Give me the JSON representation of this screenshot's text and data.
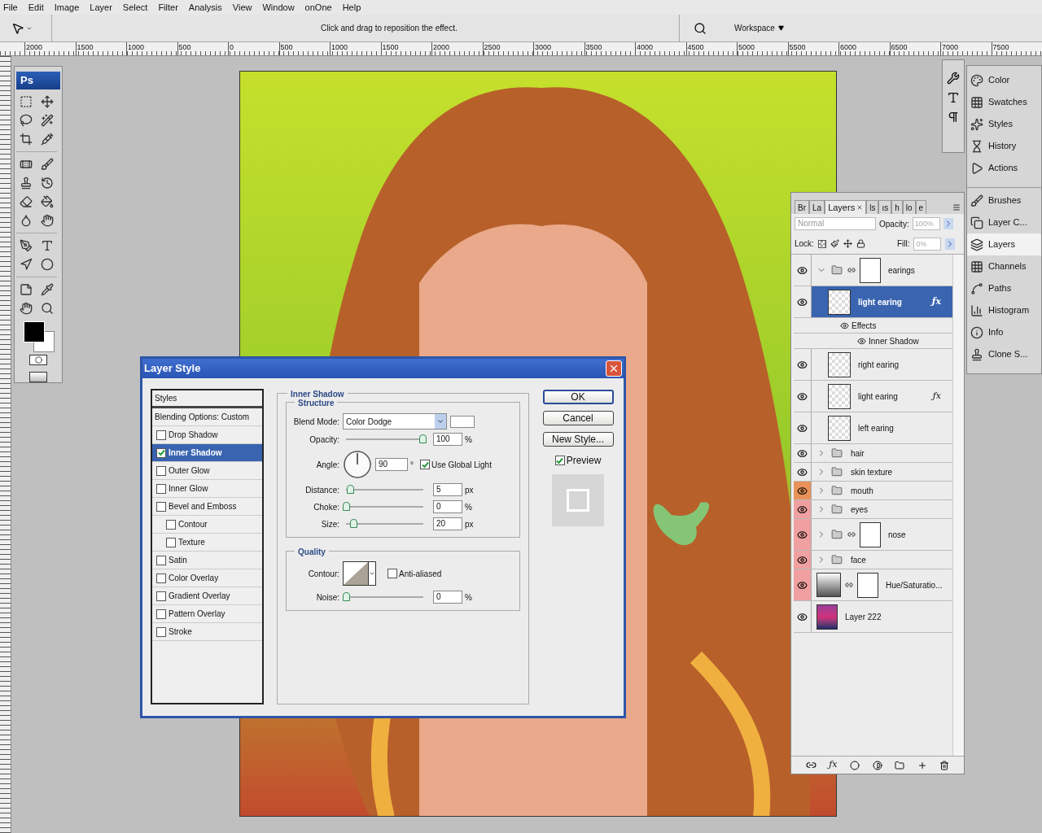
{
  "menu": [
    "File",
    "Edit",
    "Image",
    "Layer",
    "Select",
    "Filter",
    "Analysis",
    "View",
    "Window",
    "onOne",
    "Help"
  ],
  "options_bar": {
    "hint": "Click and drag to reposition the effect.",
    "workspace": "Workspace"
  },
  "ruler": [
    "2000",
    "1500",
    "1000",
    "500",
    "0",
    "500",
    "1000",
    "1500",
    "2000",
    "2500",
    "3000",
    "3500",
    "4000",
    "4500",
    "5000",
    "5500",
    "6000",
    "6500",
    "7000",
    "7500"
  ],
  "toolbox": {
    "logo": "Ps"
  },
  "dialog": {
    "title": "Layer Style",
    "styles_list": [
      {
        "label": "Styles",
        "kind": "header",
        "selected": false
      },
      {
        "label": "Blending Options: Custom",
        "kind": "header",
        "selected": false
      },
      {
        "label": "Drop Shadow",
        "kind": "option",
        "checked": false,
        "selected": false
      },
      {
        "label": "Inner Shadow",
        "kind": "option",
        "checked": true,
        "selected": true
      },
      {
        "label": "Outer Glow",
        "kind": "option",
        "checked": false,
        "selected": false
      },
      {
        "label": "Inner Glow",
        "kind": "option",
        "checked": false,
        "selected": false
      },
      {
        "label": "Bevel and Emboss",
        "kind": "option",
        "checked": false,
        "selected": false
      },
      {
        "label": "Contour",
        "kind": "sub",
        "checked": false,
        "selected": false
      },
      {
        "label": "Texture",
        "kind": "sub",
        "checked": false,
        "selected": false
      },
      {
        "label": "Satin",
        "kind": "option",
        "checked": false,
        "selected": false
      },
      {
        "label": "Color Overlay",
        "kind": "option",
        "checked": false,
        "selected": false
      },
      {
        "label": "Gradient Overlay",
        "kind": "option",
        "checked": false,
        "selected": false
      },
      {
        "label": "Pattern Overlay",
        "kind": "option",
        "checked": false,
        "selected": false
      },
      {
        "label": "Stroke",
        "kind": "option",
        "checked": false,
        "selected": false
      }
    ],
    "section_title": "Inner Shadow",
    "structure": {
      "title": "Structure",
      "blend_mode": {
        "label": "Blend Mode:",
        "value": "Color Dodge"
      },
      "opacity": {
        "label": "Opacity:",
        "value": "100",
        "unit": "%",
        "level": 1
      },
      "angle": {
        "label": "Angle:",
        "value": "90",
        "unit": "°",
        "global_light": {
          "label": "Use Global Light",
          "checked": true
        }
      },
      "distance": {
        "label": "Distance:",
        "value": "5",
        "unit": "px",
        "level": 0.05
      },
      "choke": {
        "label": "Choke:",
        "value": "0",
        "unit": "%",
        "level": 0
      },
      "size": {
        "label": "Size:",
        "value": "20",
        "unit": "px",
        "level": 0.1
      }
    },
    "quality": {
      "title": "Quality",
      "contour_label": "Contour:",
      "anti_aliased": {
        "label": "Anti-aliased",
        "checked": false
      },
      "noise": {
        "label": "Noise:",
        "value": "0",
        "unit": "%",
        "level": 0
      }
    },
    "buttons": [
      "OK",
      "Cancel",
      "New Style..."
    ],
    "preview": {
      "label": "Preview",
      "checked": true
    }
  },
  "layers_panel": {
    "tabs": [
      {
        "label": "Br",
        "selected": false
      },
      {
        "label": "La",
        "selected": false
      },
      {
        "label": "Layers",
        "selected": true
      },
      {
        "label": "ls",
        "selected": false
      },
      {
        "label": "ıs",
        "selected": false
      },
      {
        "label": "h",
        "selected": false
      },
      {
        "label": "lo",
        "selected": false
      },
      {
        "label": "e",
        "selected": false
      }
    ],
    "blend_mode": "Normal",
    "opacity_label": "Opacity:",
    "opacity": "100%",
    "lock_label": "Lock:",
    "fill_label": "Fill:",
    "fill": "0%",
    "layers": [
      {
        "kind": "group",
        "name": "earings",
        "expanded": true,
        "mask": true,
        "selected": false,
        "children": [
          {
            "kind": "layer",
            "name": "light earing",
            "fx": "ƒx",
            "selected": true,
            "children": [
              {
                "kind": "effects",
                "name": "Effects",
                "children": [
                  {
                    "kind": "effect",
                    "name": "Inner Shadow"
                  }
                ]
              }
            ]
          },
          {
            "kind": "layer",
            "name": "right earing",
            "selected": false
          },
          {
            "kind": "layer",
            "name": "light earing",
            "fx": "ƒx",
            "selected": false
          },
          {
            "kind": "layer",
            "name": "left earing",
            "selected": false
          }
        ]
      },
      {
        "kind": "group",
        "name": "hair",
        "expanded": false,
        "mask": false,
        "selected": false
      },
      {
        "kind": "group",
        "name": "skin texture",
        "expanded": false,
        "mask": false,
        "selected": false
      },
      {
        "kind": "group",
        "name": "mouth",
        "expanded": false,
        "mask": false,
        "selected": false,
        "color": "#e8925a"
      },
      {
        "kind": "group",
        "name": "eyes",
        "expanded": false,
        "mask": false,
        "selected": false,
        "color": "#f0a0a0"
      },
      {
        "kind": "group",
        "name": "nose",
        "expanded": false,
        "mask": true,
        "selected": false,
        "color": "#f0a0a0"
      },
      {
        "kind": "group",
        "name": "face",
        "expanded": false,
        "mask": false,
        "selected": false,
        "color": "#f0a0a0"
      },
      {
        "kind": "adjustment",
        "name": "Hue/Saturatio...",
        "selected": false,
        "color": "#f0a0a0"
      },
      {
        "kind": "gradient",
        "name": "Layer 222",
        "selected": false
      }
    ],
    "footer_fx": "ƒx"
  },
  "dock": [
    [
      {
        "label": "Color",
        "selected": false
      },
      {
        "label": "Swatches",
        "selected": false
      },
      {
        "label": "Styles",
        "selected": false
      },
      {
        "label": "History",
        "selected": false
      },
      {
        "label": "Actions",
        "selected": false
      }
    ],
    [
      {
        "label": "Brushes",
        "selected": false
      },
      {
        "label": "Layer C...",
        "selected": false
      },
      {
        "label": "Layers",
        "selected": true
      },
      {
        "label": "Channels",
        "selected": false
      },
      {
        "label": "Paths",
        "selected": false
      },
      {
        "label": "Histogram",
        "selected": false
      },
      {
        "label": "Info",
        "selected": false
      },
      {
        "label": "Clone S...",
        "selected": false
      }
    ]
  ]
}
